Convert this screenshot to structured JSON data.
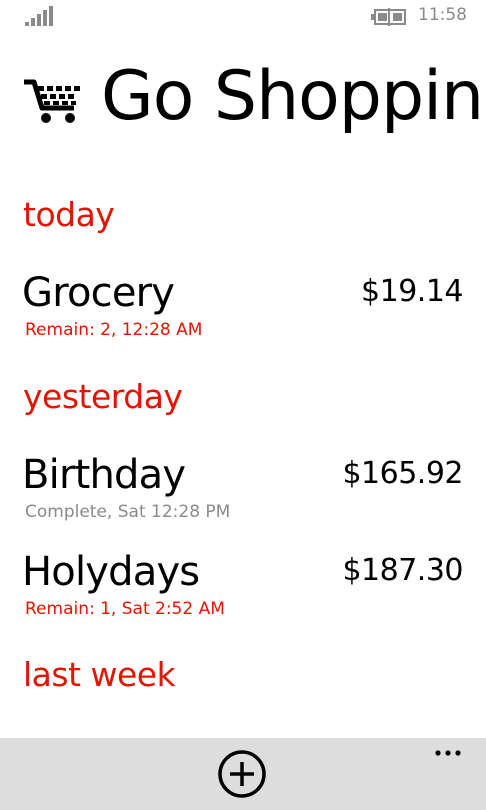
{
  "status_bar": {
    "time": "11:58",
    "signal_icon": "signal-strength-icon",
    "battery_icon": "battery-charging-icon"
  },
  "header": {
    "title": "Go Shopping",
    "icon": "shopping-cart-icon"
  },
  "groups": [
    {
      "header": "today",
      "items": [
        {
          "name": "Grocery",
          "total": "$19.14",
          "status": "Remain: 2, 12:28 AM",
          "status_color": "#e51400"
        }
      ]
    },
    {
      "header": "yesterday",
      "items": [
        {
          "name": "Birthday",
          "total": "$165.92",
          "status": "Complete, Sat 12:28 PM",
          "status_color": "#8a8a8a"
        },
        {
          "name": "Holydays",
          "total": "$187.30",
          "status": "Remain: 1, Sat 2:52 AM",
          "status_color": "#e51400"
        }
      ]
    },
    {
      "header": "last week",
      "items": []
    }
  ],
  "app_bar": {
    "add_icon": "add-circle-icon",
    "more_icon": "more-ellipsis-icon"
  },
  "colors": {
    "accent": "#e51400",
    "secondary_text": "#8a8a8a",
    "app_bar_bg": "#dddddd"
  }
}
